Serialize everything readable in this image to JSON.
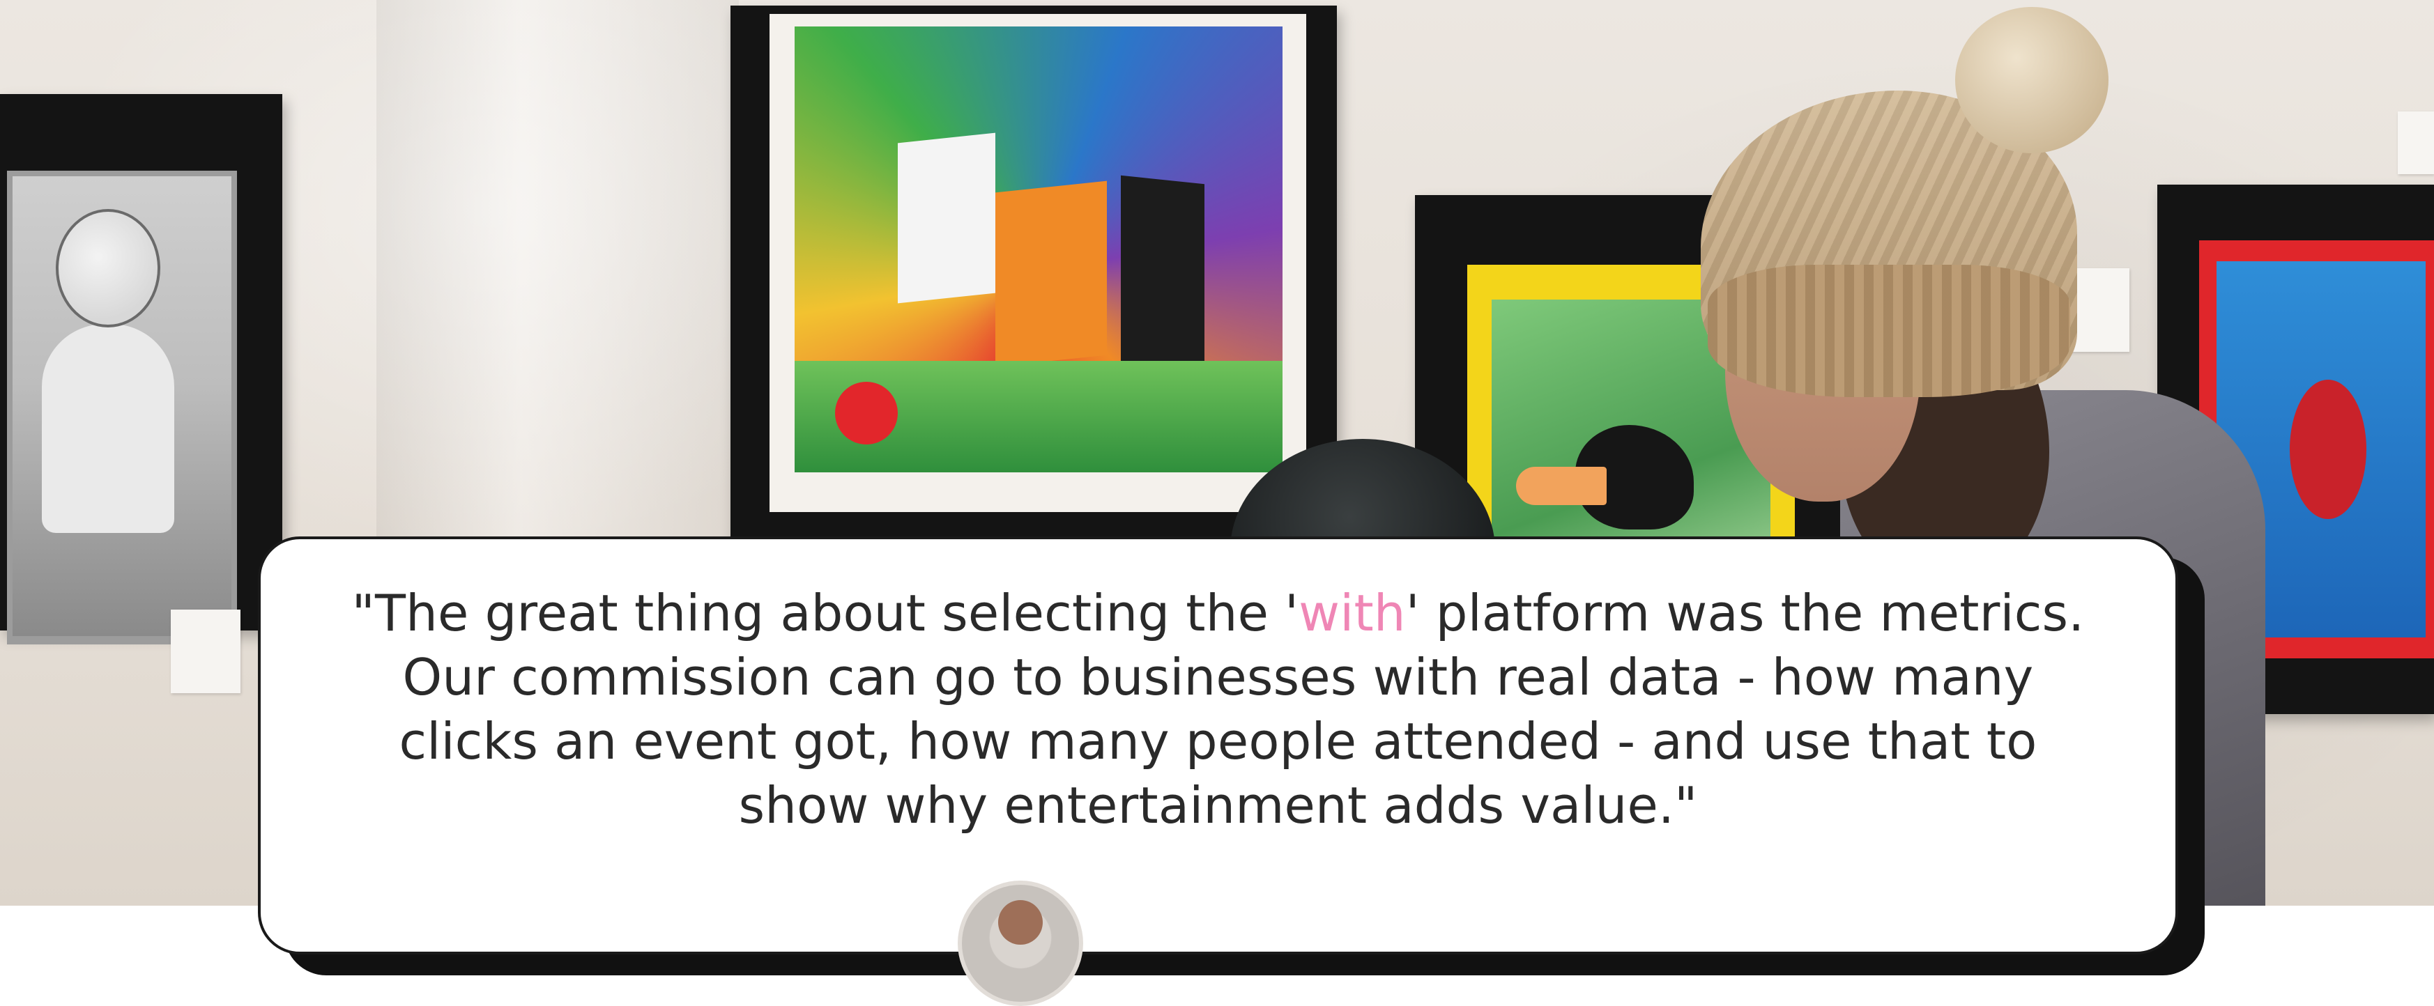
{
  "testimonial": {
    "quote_before": "\"The great thing about selecting the '",
    "quote_highlight": "with",
    "quote_after": "' platform was the metrics. Our commission can go to businesses with real data - how many clicks an event got, how many people attended - and use that to show why entertainment adds value.\""
  },
  "colors": {
    "accent": "#ef86b5",
    "card_border": "#1a1a1a",
    "text": "#2a2a2a"
  }
}
